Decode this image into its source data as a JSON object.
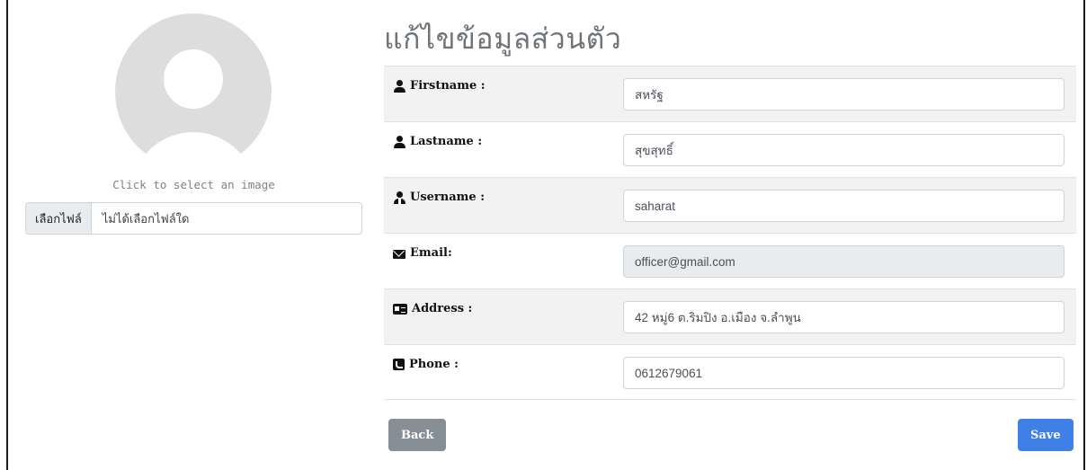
{
  "profile_image": {
    "caption": "Click to select an image"
  },
  "file_picker": {
    "button_label": "เลือกไฟล์",
    "status_text": "ไม่ได้เลือกไฟล์ใด"
  },
  "page_title": "แก้ไขข้อมูลส่วนตัว",
  "fields": [
    {
      "label": "Firstname :",
      "value": "สหรัฐ",
      "icon": "user-icon"
    },
    {
      "label": "Lastname :",
      "value": "สุขสุทธิ์",
      "icon": "user-icon"
    },
    {
      "label": "Username :",
      "value": "saharat",
      "icon": "user-tie-icon"
    },
    {
      "label": "Email:",
      "value": "officer@gmail.com",
      "icon": "envelope-icon",
      "readonly": true
    },
    {
      "label": "Address :",
      "value": "42 หมู่6 ต.ริมปิง อ.เมือง จ.ลำพูน",
      "icon": "address-card-icon"
    },
    {
      "label": "Phone :",
      "value": "0612679061",
      "icon": "phone-square-icon"
    }
  ],
  "actions": {
    "back_label": "Back",
    "save_label": "Save"
  },
  "colors": {
    "save": "#3f7fe6",
    "back": "#868e96",
    "title": "#6f7479",
    "row_stripe": "#f2f2f2"
  }
}
